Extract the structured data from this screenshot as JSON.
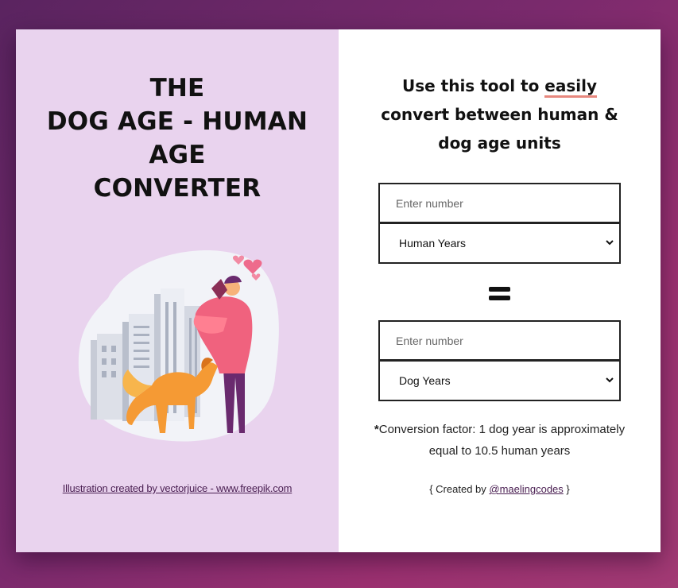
{
  "colors": {
    "left_panel": "#e9d3ee",
    "underline_accent": "#e7877d",
    "link": "#4a1f52"
  },
  "left": {
    "title_lines": [
      "THE",
      "DOG AGE - HUMAN",
      "AGE",
      "CONVERTER"
    ],
    "illustration_icon": "person-with-dog-illustration",
    "credit": "Illustration created by vectorjuice - www.freepik.com"
  },
  "right": {
    "heading_pre": "Use this tool to ",
    "heading_emph": "easily",
    "heading_post": "convert between human & dog age units",
    "input1": {
      "placeholder": "Enter number",
      "value": ""
    },
    "select1": {
      "selected": "Human Years"
    },
    "equals_icon": "equals-icon",
    "input2": {
      "placeholder": "Enter number",
      "value": ""
    },
    "select2": {
      "selected": "Dog Years"
    },
    "note_star": "*",
    "note_text": "Conversion factor: 1 dog year is approximately equal to 10.5 human years",
    "created_prefix": "{ Created by ",
    "created_link": "@maelingcodes",
    "created_suffix": " }"
  }
}
